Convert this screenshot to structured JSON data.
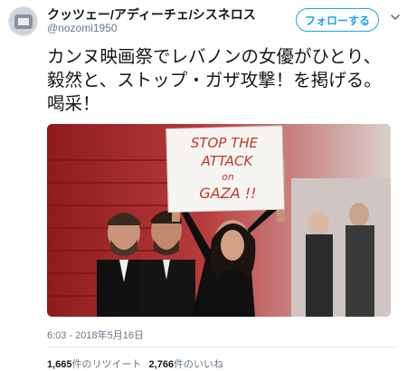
{
  "tweet": {
    "display_name": "クッツェー/アディーチェ/シスネロス",
    "handle": "@nozomi1950",
    "follow_label": "フォローする",
    "text": "カンヌ映画祭でレバノンの女優がひとり、毅然と、ストップ・ガザ攻撃！を掲げる。喝采！",
    "timestamp": "6:03 - 2018年5月16日"
  },
  "photo": {
    "sign_lines": [
      "STOP THE",
      "ATTACK",
      "on",
      "GAZA !!"
    ]
  },
  "stats": {
    "retweets_count": "1,665",
    "retweets_label": "件のリツイート",
    "likes_count": "2,766",
    "likes_label": "件のいいね"
  },
  "colors": {
    "accent": "#1da1f2",
    "text": "#14171a",
    "secondary": "#657786",
    "carpet": "#9c1f1f",
    "sign_text": "#c0392b"
  },
  "icons": [
    "avatar",
    "chevron-down-icon"
  ]
}
